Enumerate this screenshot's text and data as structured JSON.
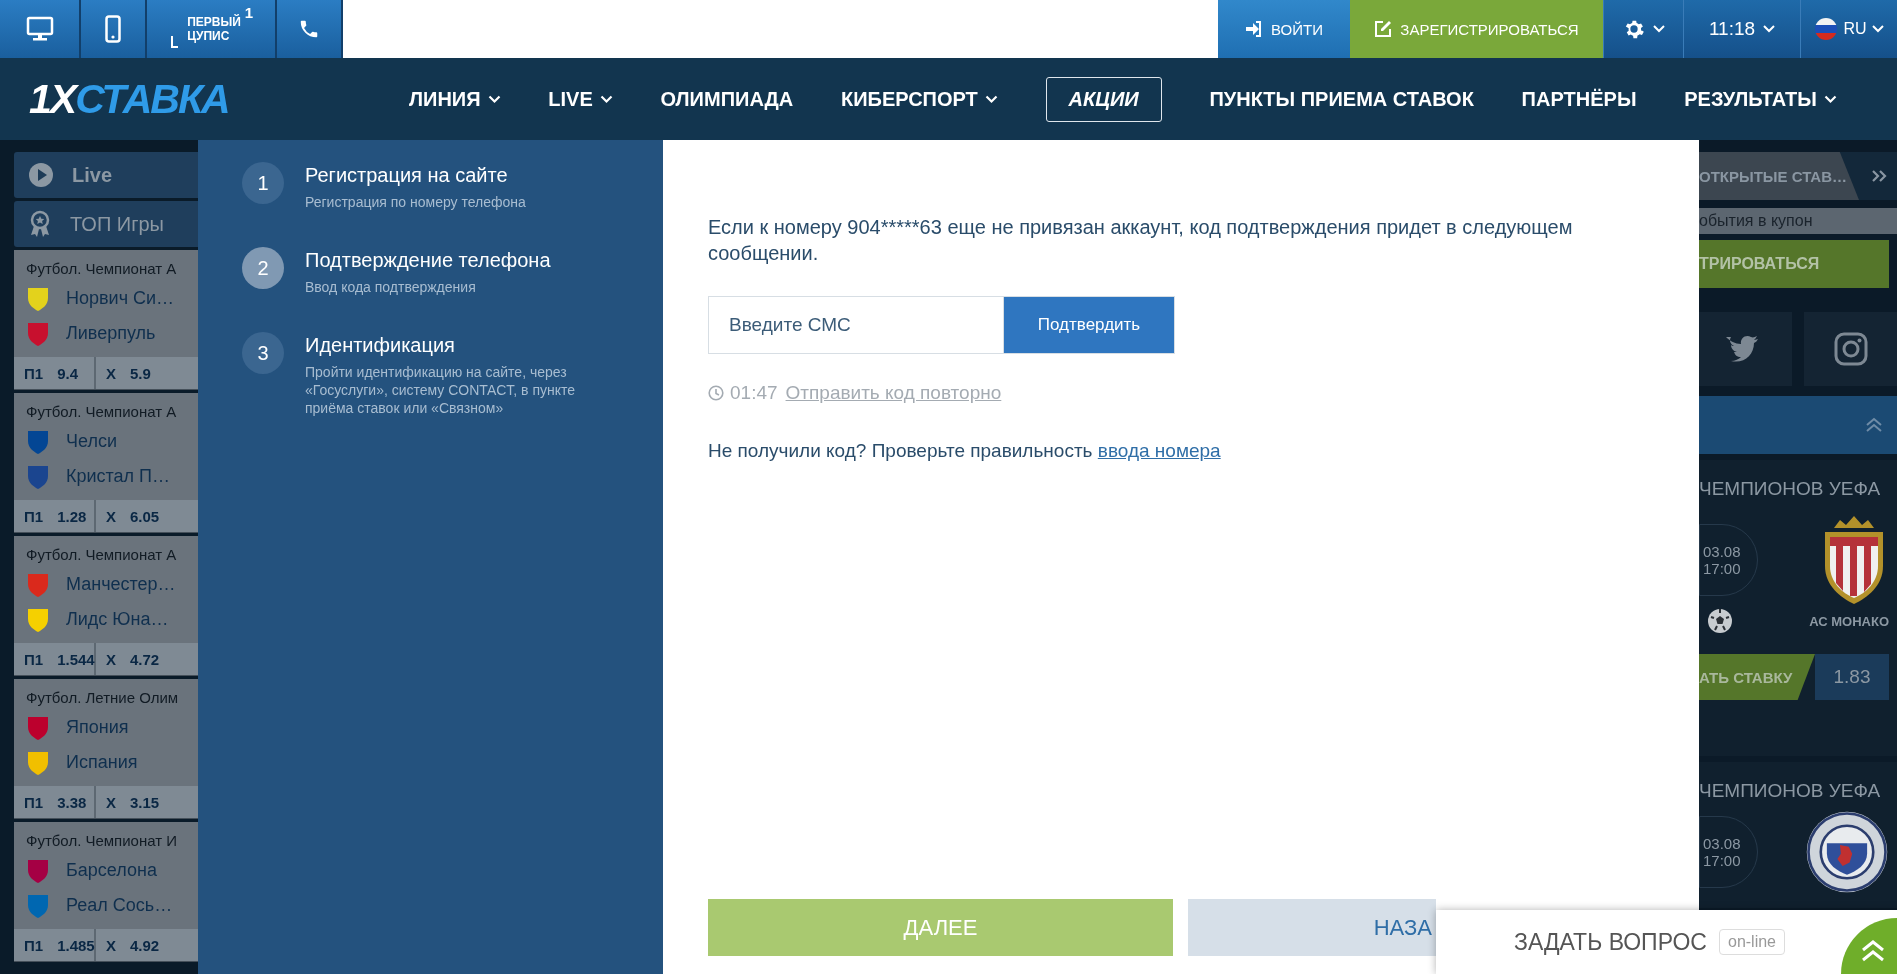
{
  "top_bar": {
    "cupis": {
      "line1": "ПЕРВЫЙ",
      "line2": "ЦУПИС",
      "mark": "1"
    },
    "login": "ВОЙТИ",
    "register": "ЗАРЕГИСТРИРОВАТЬСЯ",
    "time": "11:18",
    "language": "RU"
  },
  "logo": {
    "prefix": "1X",
    "name": "СТАВКА"
  },
  "nav": [
    {
      "label": "ЛИНИЯ",
      "dropdown": true,
      "highlighted": false
    },
    {
      "label": "LIVE",
      "dropdown": true,
      "highlighted": false
    },
    {
      "label": "ОЛИМПИАДА",
      "dropdown": false,
      "highlighted": false
    },
    {
      "label": "КИБЕРСПОРТ",
      "dropdown": true,
      "highlighted": false
    },
    {
      "label": "АКЦИИ",
      "dropdown": false,
      "highlighted": true
    },
    {
      "label": "ПУНКТЫ ПРИЕМА СТАВОК",
      "dropdown": false,
      "highlighted": false
    },
    {
      "label": "ПАРТНЁРЫ",
      "dropdown": false,
      "highlighted": false
    },
    {
      "label": "РЕЗУЛЬТАТЫ",
      "dropdown": true,
      "highlighted": false
    }
  ],
  "left_sidebar": {
    "live": "Live",
    "top_games": "ТОП Игры",
    "matches": [
      {
        "league": "Футбол. Чемпионат А",
        "teams": [
          {
            "name": "Норвич Си…",
            "color": "#e3d21c"
          },
          {
            "name": "Ливерпуль",
            "color": "#c8102e"
          }
        ],
        "odds": [
          {
            "label": "П1",
            "value": "9.4"
          },
          {
            "label": "X",
            "value": "5.9"
          }
        ]
      },
      {
        "league": "Футбол. Чемпионат А",
        "teams": [
          {
            "name": "Челси",
            "color": "#034694"
          },
          {
            "name": "Кристал П…",
            "color": "#1b458f"
          }
        ],
        "odds": [
          {
            "label": "П1",
            "value": "1.28"
          },
          {
            "label": "X",
            "value": "6.05"
          }
        ]
      },
      {
        "league": "Футбол. Чемпионат А",
        "teams": [
          {
            "name": "Манчестер…",
            "color": "#da291c"
          },
          {
            "name": "Лидс Юна…",
            "color": "#f5d000"
          }
        ],
        "odds": [
          {
            "label": "П1",
            "value": "1.544"
          },
          {
            "label": "X",
            "value": "4.72"
          }
        ]
      },
      {
        "league": "Футбол. Летние Олим",
        "teams": [
          {
            "name": "Япония",
            "color": "#bc002d"
          },
          {
            "name": "Испания",
            "color": "#f1bf00"
          }
        ],
        "odds": [
          {
            "label": "П1",
            "value": "3.38"
          },
          {
            "label": "X",
            "value": "3.15"
          }
        ]
      },
      {
        "league": "Футбол. Чемпионат И",
        "teams": [
          {
            "name": "Барселона",
            "color": "#a50044"
          },
          {
            "name": "Реал Сось…",
            "color": "#0067b1"
          }
        ],
        "odds": [
          {
            "label": "П1",
            "value": "1.485"
          },
          {
            "label": "X",
            "value": "4.92"
          }
        ]
      }
    ]
  },
  "steps": [
    {
      "number": "1",
      "title": "Регистрация на сайте",
      "subtitle": "Регистрация по номеру телефона",
      "active": false
    },
    {
      "number": "2",
      "title": "Подтверждение телефона",
      "subtitle": "Ввод кода подтверждения",
      "active": true
    },
    {
      "number": "3",
      "title": "Идентификация",
      "subtitle": "Пройти идентификацию на сайте, через «Госуслуги», систему CONTACT, в пункте приёма ставок или «Связном»",
      "active": false
    }
  ],
  "modal": {
    "message": "Если к номеру 904*****63 еще не привязан аккаунт, код подтверждения придет в следующем сообщении.",
    "sms_field": {
      "placeholder": "Введите СМС"
    },
    "confirm_button": "Подтвердить",
    "timer": "01:47",
    "resend_link": "Отправить код повторно",
    "help_text": "Не получили код? Проверьте правильность",
    "help_link": "ввода номера",
    "next_button": "ДАЛЕЕ",
    "back_button": "НАЗА"
  },
  "right_sidebar": {
    "open_bets_tab": "ОТКРЫТЫЕ СТАВ…",
    "coupon_hint": "обытия в купон",
    "register_button": "ТРИРОВАТЬСЯ",
    "promos": [
      {
        "kind": "shield",
        "title": "ЧЕМПИОНОВ УЕФА",
        "date": "03.08",
        "time": "17:00",
        "team": "АС МОНАКО",
        "bet_button": "АТЬ СТАВКУ",
        "odd": "1.83"
      },
      {
        "kind": "round",
        "title": "ЧЕМПИОНОВ УЕФА",
        "date": "03.08",
        "time": "17:00"
      }
    ]
  },
  "chat": {
    "label": "ЗАДАТЬ ВОПРОС",
    "status": "on-line"
  }
}
